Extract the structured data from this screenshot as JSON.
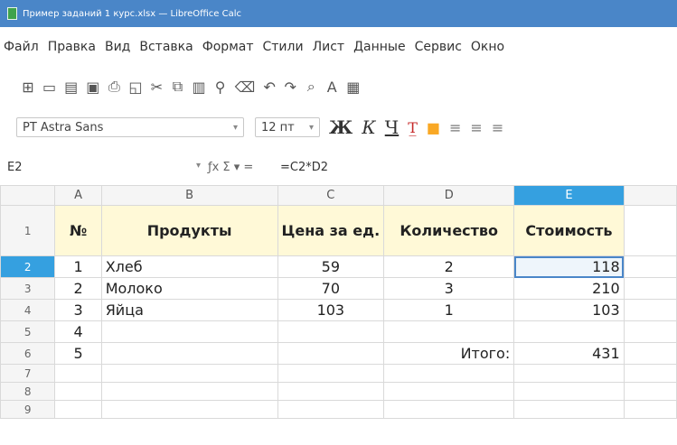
{
  "window": {
    "title": "Пример заданий 1 курс.xlsx — LibreOffice Calc"
  },
  "menu": [
    "Файл",
    "Правка",
    "Вид",
    "Вставка",
    "Формат",
    "Стили",
    "Лист",
    "Данные",
    "Сервис",
    "Окно"
  ],
  "toolbar": {
    "icons": [
      "grid-icon",
      "new-icon",
      "template-icon",
      "save-icon",
      "print-icon",
      "preview-icon",
      "cut-icon",
      "copy-icon",
      "paste-icon",
      "clone-icon",
      "clear-icon",
      "undo-icon",
      "redo-icon",
      "find-icon",
      "spelling-icon",
      "row-icon"
    ]
  },
  "format": {
    "font": "PT Astra Sans",
    "size": "12 пт",
    "bold": "Ж",
    "italic": "К",
    "underline": "Ч"
  },
  "formula_bar": {
    "cell": "E2",
    "icons": "ƒx Σ ▾ =",
    "formula": "=C2*D2"
  },
  "columns": [
    "A",
    "B",
    "C",
    "D",
    "E"
  ],
  "header": {
    "no": "№",
    "product": "Продукты",
    "price": "Цена за ед.",
    "qty": "Количество",
    "cost": "Стоимость"
  },
  "rows": [
    {
      "num": "2",
      "no": "1",
      "product": "Хлеб",
      "price": "59",
      "qty": "2",
      "cost": "118"
    },
    {
      "num": "3",
      "no": "2",
      "product": "Молоко",
      "price": "70",
      "qty": "3",
      "cost": "210"
    },
    {
      "num": "4",
      "no": "3",
      "product": "Яйца",
      "price": "103",
      "qty": "1",
      "cost": "103"
    },
    {
      "num": "5",
      "no": "4",
      "product": "",
      "price": "",
      "qty": "",
      "cost": ""
    },
    {
      "num": "6",
      "no": "5",
      "product": "",
      "price": "",
      "qty": "Итого:",
      "cost": "431"
    }
  ],
  "empty_rows": [
    "7",
    "8",
    "9"
  ],
  "selected_cell": "E2",
  "accent": "#35a0e0"
}
